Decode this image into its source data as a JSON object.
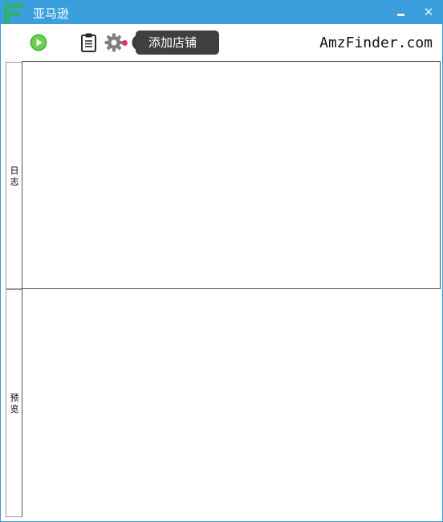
{
  "window": {
    "title": "亚马逊",
    "logo_letter": "F",
    "brand_color": "#2fb07a",
    "titlebar_color": "#3a9fdc"
  },
  "controls": {
    "minimize_icon": "minimize-icon",
    "close_symbol": "✕"
  },
  "toolbar": {
    "tooltip": "添加店铺",
    "brand": "AmzFinder.com",
    "icons": [
      "play-icon",
      "clipboard-icon",
      "gear-icon",
      "power-icon"
    ]
  },
  "panels": {
    "log_tab": "日志",
    "preview_tab": "预览"
  }
}
